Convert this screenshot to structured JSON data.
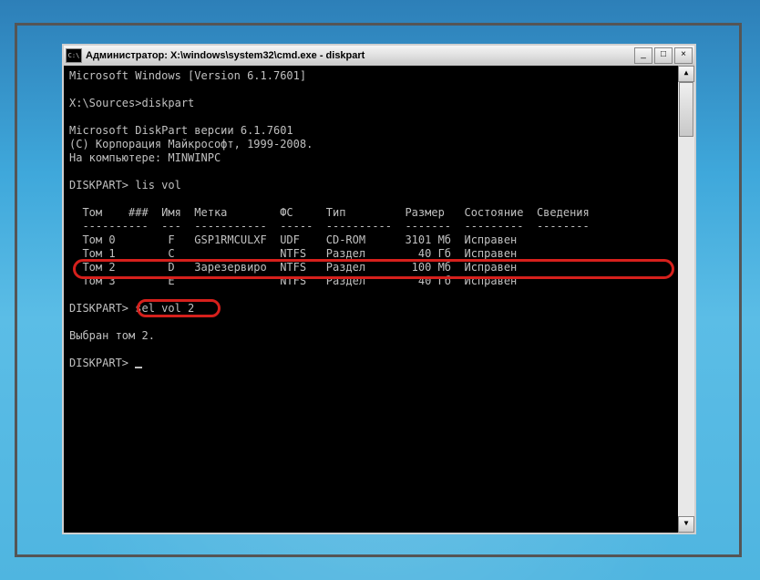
{
  "window": {
    "title": "Администратор: X:\\windows\\system32\\cmd.exe - diskpart"
  },
  "term": {
    "line1": "Microsoft Windows [Version 6.1.7601]",
    "blank1": "",
    "prompt1": "X:\\Sources>diskpart",
    "blank2": "",
    "dp1": "Microsoft DiskPart версии 6.1.7601",
    "dp2": "(C) Корпорация Майкрософт, 1999-2008.",
    "dp3": "На компьютере: MINWINPC",
    "blank3": "",
    "promptlis": "DISKPART> lis vol",
    "header": "  Том    ###  Имя  Метка        ФС     Тип         Размер   Состояние  Сведения",
    "rule": "  ----------  ---  -----------  -----  ----------  -------  ---------  --------",
    "row0": "  Том 0        F   GSP1RMCULXF  UDF    CD-ROM      3101 Мб  Исправен",
    "row1mask": "  Том 1        C                NTFS   Раздел        40 Гб  Исправен",
    "row2": "  Том 2        D   Зарезервиро  NTFS   Раздел       100 Мб  Исправен",
    "row3mask": "  Том 3        E                NTFS   Раздел        40 Гб  Исправен",
    "blank4": "",
    "promptsel": "DISKPART> sel vol 2",
    "blank5": "",
    "selresp": "Выбран том 2.",
    "blank6": "",
    "promptcur": "DISKPART> "
  },
  "highlights": {
    "row_circle": "highlighted-volume-2-row",
    "cmd_circle": "highlighted-sel-vol-2"
  }
}
